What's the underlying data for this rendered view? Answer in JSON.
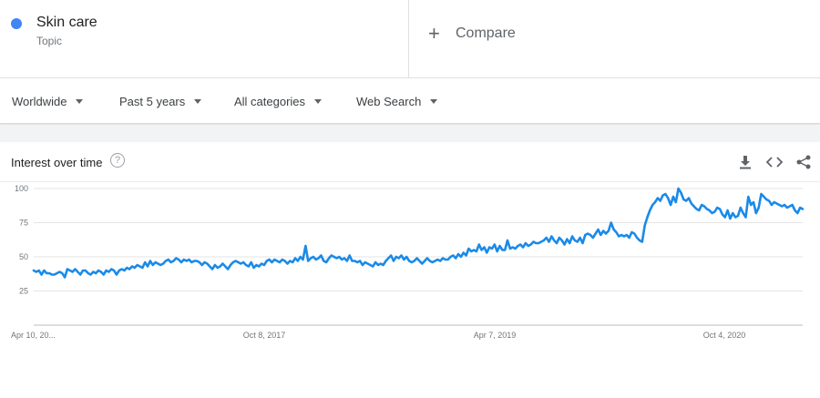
{
  "term": {
    "name": "Skin care",
    "type": "Topic",
    "color": "#4285f4"
  },
  "compare": {
    "label": "Compare",
    "icon": "plus-icon"
  },
  "filters": [
    {
      "label": "Worldwide"
    },
    {
      "label": "Past 5 years"
    },
    {
      "label": "All categories"
    },
    {
      "label": "Web Search"
    }
  ],
  "card": {
    "title": "Interest over time",
    "help_icon": "help-icon",
    "help_glyph": "?",
    "tools": [
      "download-icon",
      "embed-icon",
      "share-icon"
    ]
  },
  "chart_data": {
    "type": "line",
    "ylim": [
      0,
      100
    ],
    "yticks": [
      "100",
      "75",
      "50",
      "25"
    ],
    "xticks": [
      "Apr 10, 20...",
      "Oct 8, 2017",
      "Apr 7, 2019",
      "Oct 4, 2020"
    ],
    "grid": true,
    "series": [
      {
        "color": "#1a8ae8",
        "values": [
          40,
          39,
          40,
          37,
          40,
          38,
          38,
          37,
          37,
          38,
          39,
          38,
          35,
          41,
          40,
          39,
          41,
          39,
          37,
          40,
          40,
          38,
          37,
          39,
          38,
          40,
          39,
          37,
          40,
          39,
          41,
          40,
          37,
          40,
          41,
          40,
          42,
          41,
          43,
          42,
          44,
          43,
          42,
          46,
          43,
          47,
          44,
          46,
          45,
          44,
          45,
          47,
          48,
          46,
          47,
          49,
          48,
          46,
          48,
          47,
          48,
          46,
          47,
          47,
          46,
          44,
          46,
          45,
          43,
          41,
          44,
          42,
          43,
          45,
          43,
          41,
          44,
          46,
          47,
          46,
          45,
          46,
          44,
          43,
          46,
          42,
          44,
          43,
          45,
          44,
          47,
          48,
          46,
          48,
          47,
          46,
          48,
          47,
          45,
          47,
          46,
          49,
          47,
          50,
          48,
          58,
          47,
          49,
          50,
          48,
          49,
          51,
          47,
          46,
          49,
          51,
          50,
          49,
          50,
          48,
          49,
          47,
          51,
          47,
          47,
          46,
          47,
          44,
          46,
          45,
          44,
          43,
          46,
          44,
          45,
          44,
          47,
          49,
          51,
          47,
          50,
          49,
          51,
          48,
          50,
          47,
          46,
          47,
          49,
          47,
          45,
          47,
          49,
          47,
          46,
          47,
          48,
          47,
          49,
          48,
          48,
          50,
          51,
          49,
          52,
          50,
          53,
          51,
          56,
          54,
          55,
          54,
          59,
          55,
          57,
          53,
          57,
          56,
          59,
          54,
          58,
          55,
          55,
          62,
          56,
          57,
          56,
          58,
          59,
          57,
          60,
          58,
          59,
          61,
          60,
          60,
          61,
          62,
          64,
          61,
          65,
          62,
          60,
          64,
          62,
          59,
          63,
          60,
          65,
          62,
          61,
          64,
          60,
          66,
          67,
          66,
          64,
          67,
          70,
          66,
          69,
          67,
          69,
          75,
          70,
          68,
          65,
          66,
          65,
          66,
          64,
          68,
          67,
          64,
          62,
          61,
          73,
          79,
          84,
          88,
          90,
          93,
          91,
          95,
          96,
          93,
          88,
          94,
          90,
          100,
          97,
          92,
          91,
          93,
          89,
          87,
          85,
          84,
          88,
          87,
          85,
          84,
          82,
          83,
          86,
          85,
          81,
          79,
          84,
          78,
          82,
          79,
          80,
          86,
          82,
          79,
          94,
          88,
          90,
          82,
          86,
          96,
          94,
          92,
          91,
          88,
          90,
          89,
          88,
          87,
          88,
          86,
          87,
          88,
          84,
          82,
          86,
          85
        ]
      }
    ]
  }
}
